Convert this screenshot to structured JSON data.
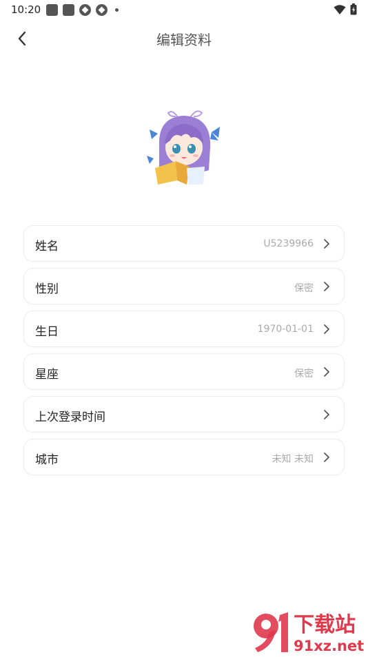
{
  "status_bar": {
    "time": "10:20"
  },
  "header": {
    "title": "编辑资料"
  },
  "profile_rows": [
    {
      "label": "姓名",
      "value": "U5239966"
    },
    {
      "label": "性别",
      "value": "保密"
    },
    {
      "label": "生日",
      "value": "1970-01-01"
    },
    {
      "label": "星座",
      "value": "保密"
    },
    {
      "label": "上次登录时间",
      "value": ""
    },
    {
      "label": "城市",
      "value": "未知 未知"
    }
  ],
  "watermark": {
    "brand": "下载站",
    "domain": "91xz.net"
  },
  "colors": {
    "text": "#222222",
    "muted": "#aaaaaa",
    "border": "#ececec",
    "hair": "#9b7fd4",
    "watermark": "#e0394c"
  }
}
